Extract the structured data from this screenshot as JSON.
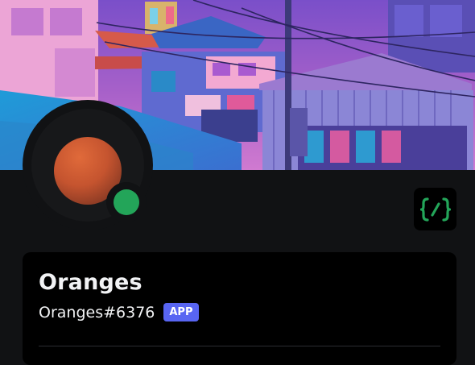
{
  "banner": {
    "image": "city street illustration"
  },
  "profile": {
    "avatar": "orange-orb-avatar",
    "status": "online",
    "status_color": "#23a559",
    "display_name": "Oranges",
    "tag": "Oranges#6376",
    "badge": "APP",
    "badge_color": "#5865f2"
  },
  "icons": {
    "command_icon": "slash-command-icon",
    "command_color": "#23a559"
  }
}
